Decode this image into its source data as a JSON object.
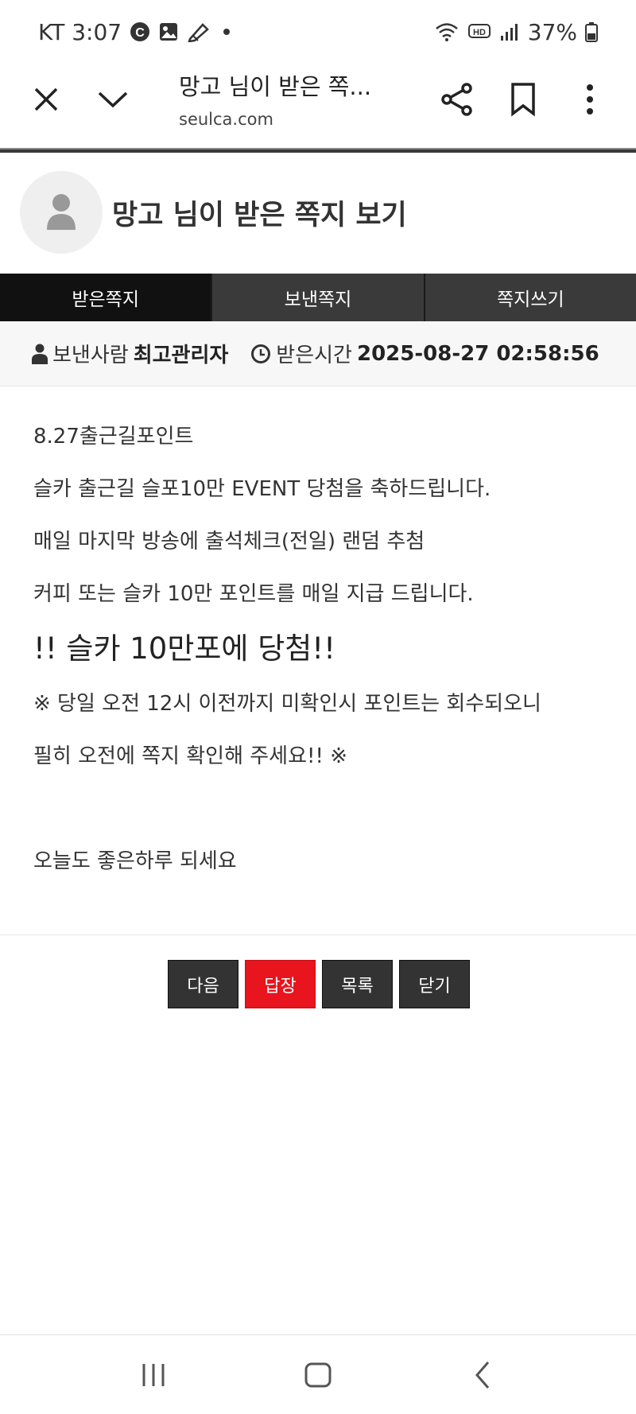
{
  "status_bar": {
    "carrier_time": "KT 3:07",
    "battery": "37%",
    "icons": [
      "c-badge-icon",
      "image-icon",
      "pen-icon",
      "dot-icon",
      "wifi-icon",
      "hd-icon",
      "signal-icon",
      "battery-icon"
    ]
  },
  "toolbar": {
    "title": "망고 님이 받은 쪽...",
    "url": "seulca.com",
    "icons": [
      "close-icon",
      "chevron-down-icon",
      "share-icon",
      "bookmark-icon",
      "more-vert-icon"
    ]
  },
  "header": {
    "title": "망고 님이 받은 쪽지 보기"
  },
  "tabs": [
    {
      "label": "받은쪽지",
      "active": true
    },
    {
      "label": "보낸쪽지",
      "active": false
    },
    {
      "label": "쪽지쓰기",
      "active": false
    }
  ],
  "info": {
    "sender_label": "보낸사람",
    "sender_value": "최고관리자",
    "time_label": "받은시간",
    "time_value": "2025-08-27 02:58:56"
  },
  "message": {
    "lines": [
      "8.27출근길포인트",
      "슬카 출근길 슬포10만 EVENT 당첨을 축하드립니다.",
      "매일 마지막 방송에 출석체크(전일) 랜덤 추첨",
      "커피 또는 슬카 10만 포인트를 매일 지급 드립니다.",
      "!! 슬카 10만포에 당첨!!",
      "※ 당일 오전 12시 이전까지 미확인시 포인트는 회수되오니",
      "필히 오전에 쪽지 확인해 주세요!! ※",
      "오늘도 좋은하루 되세요"
    ]
  },
  "actions": {
    "next": "다음",
    "reply": "답장",
    "list": "목록",
    "close": "닫기"
  },
  "colors": {
    "accent_red": "#e8141e",
    "tab_active": "#111111",
    "tab_inactive": "#3a3a3a"
  }
}
